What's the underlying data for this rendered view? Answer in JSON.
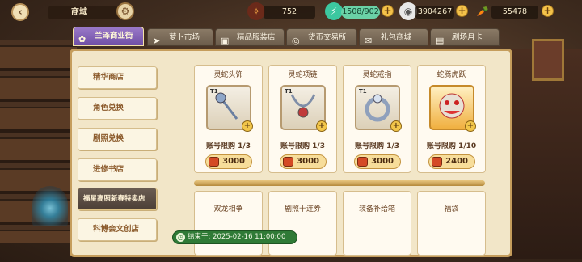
{
  "header": {
    "title": "商城",
    "back_icon": "back-arrow-icon"
  },
  "currencies": [
    {
      "name": "gift-fragment",
      "value": "752",
      "icon": "fire-gift-icon"
    },
    {
      "name": "stamina",
      "value": "1508/902",
      "icon": "energy-bottle-icon"
    },
    {
      "name": "silver-coin",
      "value": "3904267",
      "icon": "coin-icon"
    },
    {
      "name": "carrot",
      "value": "55478",
      "icon": "carrot-icon"
    }
  ],
  "tabs": [
    {
      "label": "兰泽商业街",
      "icon": "feather-icon",
      "active": true
    },
    {
      "label": "萝卜市场",
      "icon": "carrot-icon"
    },
    {
      "label": "精品服装店",
      "icon": "clothes-icon"
    },
    {
      "label": "货币交易所",
      "icon": "exchange-icon"
    },
    {
      "label": "礼包商城",
      "icon": "gift-icon"
    },
    {
      "label": "剧场月卡",
      "icon": "card-icon"
    }
  ],
  "sidebar": {
    "items": [
      {
        "label": "精华商店"
      },
      {
        "label": "角色兑换"
      },
      {
        "label": "剧照兑换"
      },
      {
        "label": "进修书店"
      },
      {
        "label": "福星高照新春特卖店",
        "active": true
      },
      {
        "label": "科博会文创店"
      }
    ]
  },
  "products": [
    {
      "name": "灵蛇头饰",
      "tier": "T1",
      "limit": "账号限购 1/3",
      "price": "3000"
    },
    {
      "name": "灵蛇项链",
      "tier": "T1",
      "limit": "账号限购 1/3",
      "price": "3000"
    },
    {
      "name": "灵蛇戒指",
      "tier": "T1",
      "limit": "账号限购 1/3",
      "price": "3000"
    },
    {
      "name": "蛇腾虎跃",
      "tier": "",
      "limit": "账号限购 1/10",
      "price": "2400"
    }
  ],
  "products_row2": [
    {
      "name": "双龙相争"
    },
    {
      "name": "剧照十连券"
    },
    {
      "name": "装备补给箱"
    },
    {
      "name": "福袋"
    }
  ],
  "end_time": {
    "label": "结束于:",
    "value": "2025-02-16 11:00:00"
  },
  "colors": {
    "accent_tab": "#7a58b0",
    "timer_bg": "#2f7a36",
    "panel": "#f2e6c8"
  }
}
